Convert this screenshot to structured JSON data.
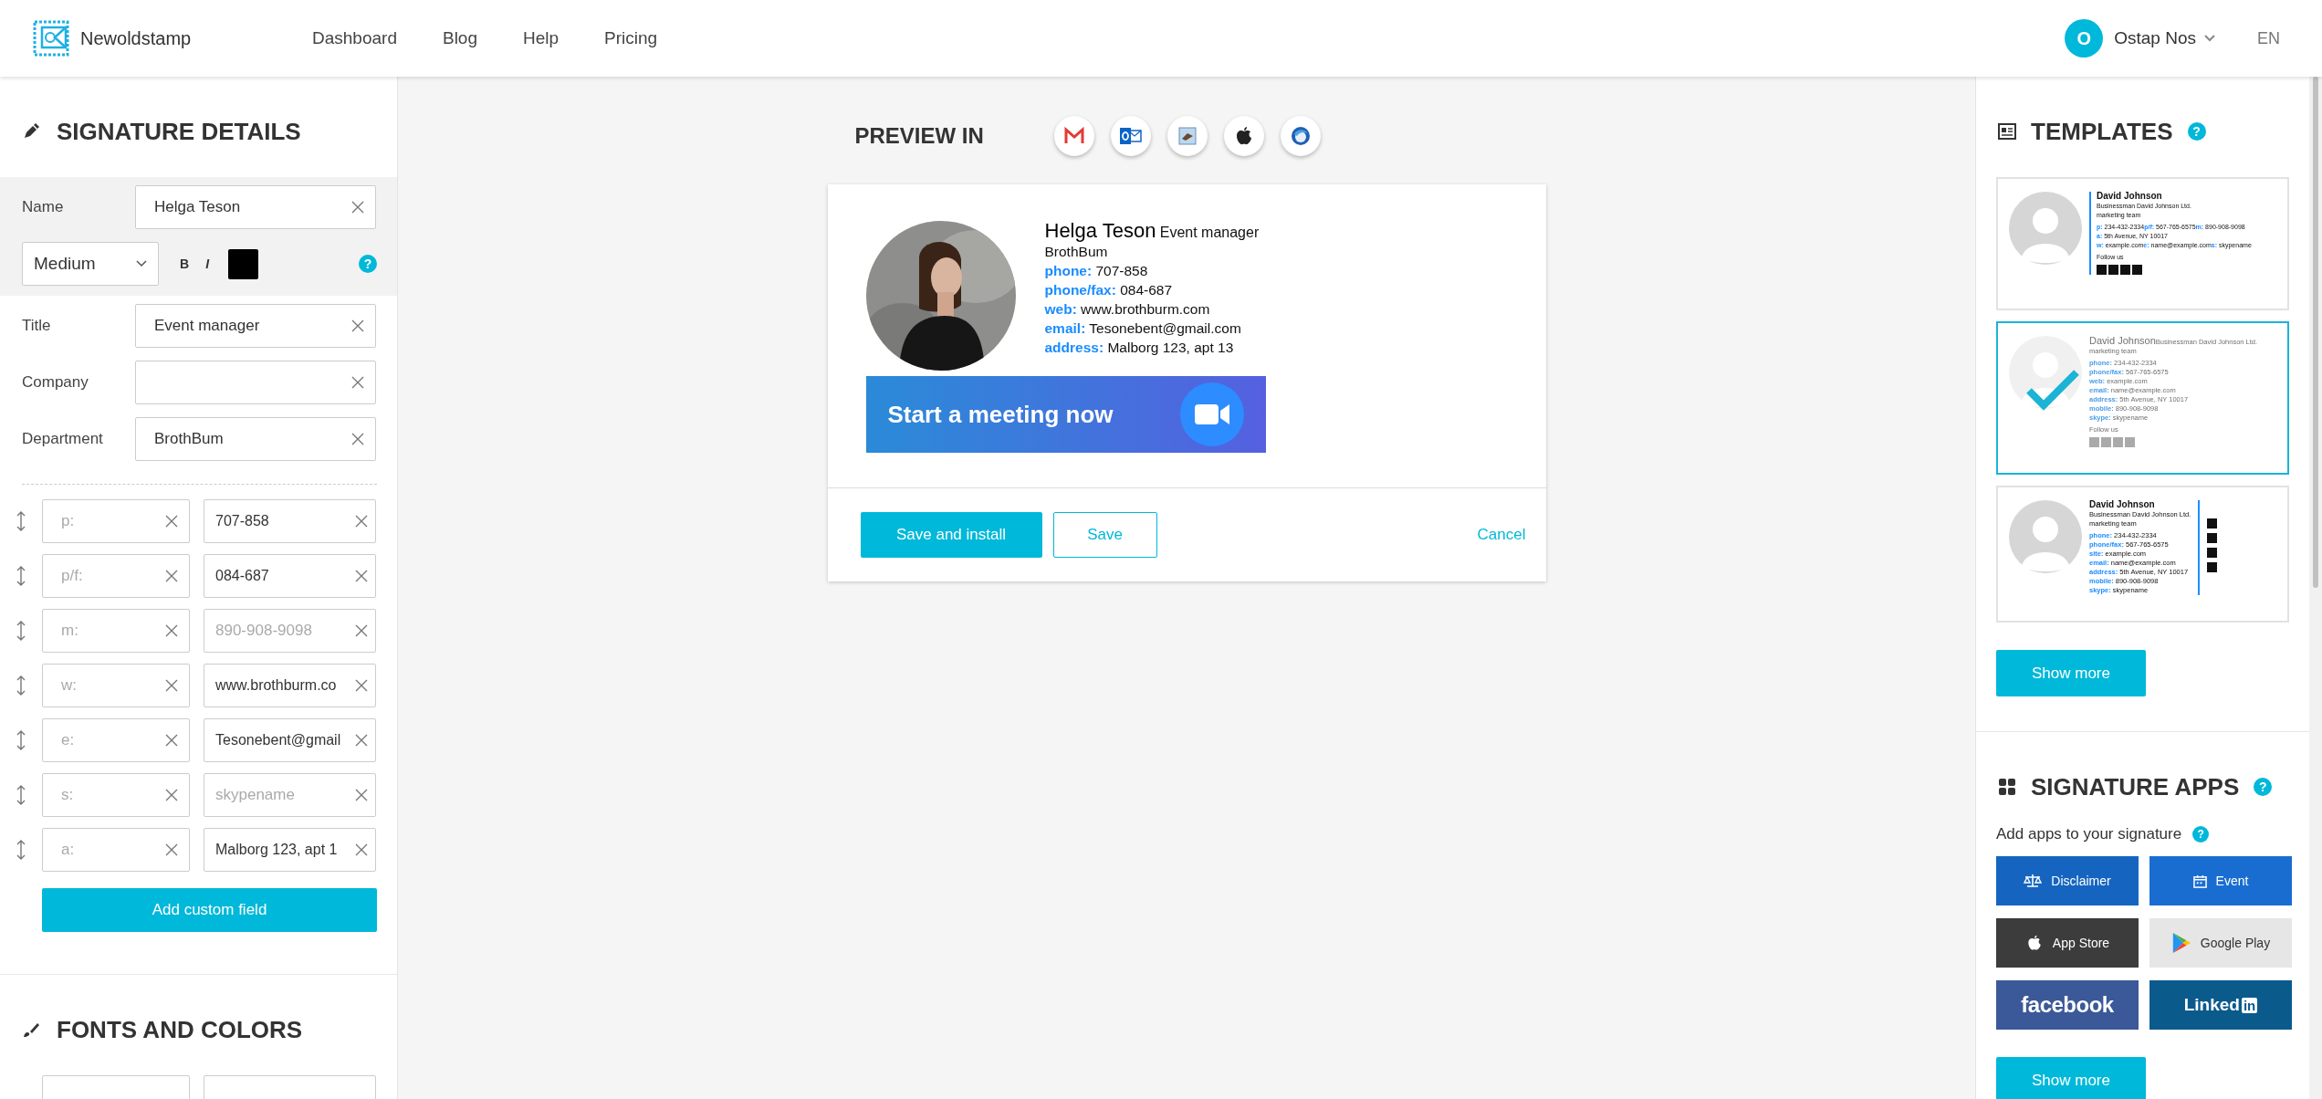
{
  "header": {
    "brand": "Newoldstamp",
    "nav": [
      {
        "label": "Dashboard"
      },
      {
        "label": "Blog"
      },
      {
        "label": "Help"
      },
      {
        "label": "Pricing"
      }
    ],
    "avatar": "O",
    "user": "Ostap Nos",
    "language": "EN"
  },
  "details": {
    "title": "SIGNATURE DETAILS",
    "name": {
      "label": "Name",
      "value": "Helga Teson",
      "size": "Medium",
      "bold": "B",
      "italic": "I",
      "color": "#000000",
      "help": "?"
    },
    "fields": [
      {
        "label": "Title",
        "value": "Event manager"
      },
      {
        "label": "Company"
      },
      {
        "label": "Department",
        "value": "BrothBum"
      }
    ],
    "custom_fields": [
      {
        "label_placeholder": "p:",
        "value": "707-858"
      },
      {
        "label_placeholder": "p/f:",
        "value": "084-687"
      },
      {
        "label_placeholder": "m:",
        "placeholder": "890-908-9098"
      },
      {
        "label_placeholder": "w:",
        "value": "www.brothburm.co"
      },
      {
        "label_placeholder": "e:",
        "value": "Tesonebent@gmail"
      },
      {
        "label_placeholder": "s:",
        "placeholder": "skypename"
      },
      {
        "label_placeholder": "a:",
        "value": "Malborg 123, apt 1"
      }
    ],
    "add_button": "Add custom field"
  },
  "fonts": {
    "title": "FONTS AND COLORS"
  },
  "preview": {
    "title": "PREVIEW IN",
    "clients": [
      {
        "kind": "gmail"
      },
      {
        "kind": "outlook"
      },
      {
        "kind": "mail"
      },
      {
        "kind": "apple"
      },
      {
        "kind": "thunderbird"
      }
    ],
    "signature": {
      "name": "Helga Teson",
      "title": "Event manager",
      "company": "BrothBum",
      "lines": [
        {
          "label": "phone:",
          "value": "707-858"
        },
        {
          "label": "phone/fax:",
          "value": "084-687"
        },
        {
          "label": "web:",
          "value": "www.brothburm.com"
        },
        {
          "label": "email:",
          "value": "Tesonebent@gmail.com"
        },
        {
          "label": "address:",
          "value": "Malborg 123, apt 13"
        }
      ],
      "banner": "Start a meeting now"
    },
    "buttons": {
      "primary": "Save and install",
      "secondary": "Save",
      "cancel": "Cancel"
    }
  },
  "templates": {
    "title": "TEMPLATES",
    "help": "?",
    "items": [
      {
        "kind": "inline",
        "selected": false,
        "name": "David Johnson",
        "company": "Businessman David Johnson Ltd.",
        "department": "marketing team",
        "rows": [
          [
            {
              "label": "p:",
              "value": "234-432-2334"
            },
            {
              "label": "p/f:",
              "value": "567-765-6575"
            },
            {
              "label": "m:",
              "value": "890-908-9098"
            }
          ],
          [
            {
              "label": "a:",
              "value": "5th Avenue, NY 10017"
            }
          ],
          [
            {
              "label": "w:",
              "value": "example.com"
            },
            {
              "label": "e:",
              "value": "name@example.com"
            },
            {
              "label": "s:",
              "value": "skypename"
            }
          ]
        ],
        "follow": "Follow us"
      },
      {
        "kind": "stacked",
        "selected": true,
        "name": "David Johnson",
        "company": "Businessman David Johnson Ltd.",
        "department": "marketing team",
        "rows": [
          [
            {
              "label": "phone:",
              "value": "234-432-2334"
            }
          ],
          [
            {
              "label": "phone/fax:",
              "value": "567-765-6575"
            }
          ],
          [
            {
              "label": "web:",
              "value": "example.com"
            }
          ],
          [
            {
              "label": "email:",
              "value": "name@example.com"
            }
          ],
          [
            {
              "label": "address:",
              "value": "5th Avenue, NY 10017"
            }
          ],
          [
            {
              "label": "mobile:",
              "value": "890-908-9098"
            }
          ],
          [
            {
              "label": "skype:",
              "value": "skypename"
            }
          ]
        ],
        "follow": "Follow us"
      },
      {
        "kind": "side",
        "selected": false,
        "name": "David Johnson",
        "company": "Businessman David Johnson Ltd.",
        "department": "marketing team",
        "rows": [
          [
            {
              "label": "phone:",
              "value": "234-432-2334"
            }
          ],
          [
            {
              "label": "phone/fax:",
              "value": "567-765-6575"
            }
          ],
          [
            {
              "label": "site:",
              "value": "example.com"
            }
          ],
          [
            {
              "label": "email:",
              "value": "name@example.com"
            }
          ],
          [
            {
              "label": "address:",
              "value": "5th Avenue, NY 10017"
            }
          ],
          [
            {
              "label": "mobile:",
              "value": "890-908-9098"
            }
          ],
          [
            {
              "label": "skype:",
              "value": "skypename"
            }
          ]
        ]
      }
    ],
    "more": "Show more"
  },
  "apps": {
    "title": "SIGNATURE APPS",
    "help": "?",
    "subtitle": "Add apps to your signature",
    "subtitle_help": "?",
    "items": [
      {
        "kind": "disclaimer",
        "label": "Disclaimer"
      },
      {
        "kind": "event",
        "label": "Event"
      },
      {
        "kind": "appstore",
        "label": "App Store"
      },
      {
        "kind": "googleplay",
        "label": "Google Play"
      },
      {
        "kind": "facebook",
        "label": "facebook"
      },
      {
        "kind": "linkedin",
        "label": "Linked",
        "badge": "in"
      }
    ],
    "more": "Show more"
  }
}
